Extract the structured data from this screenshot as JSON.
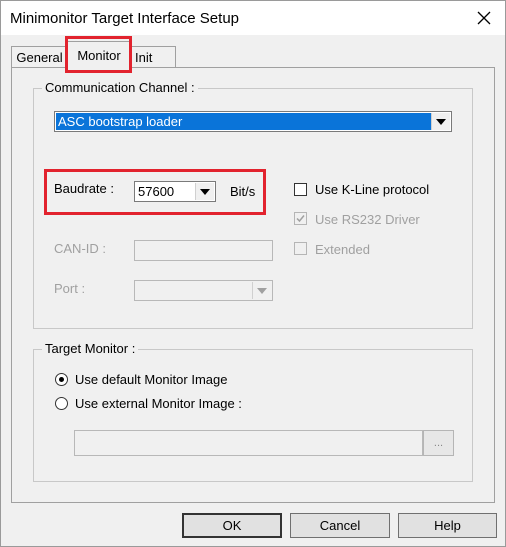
{
  "window": {
    "title": "Minimonitor Target Interface Setup"
  },
  "icons": {
    "close": "close-icon"
  },
  "tabs": [
    {
      "label": "General"
    },
    {
      "label": "Monitor",
      "selected": true
    },
    {
      "label": "Init"
    }
  ],
  "communication": {
    "legend": "Communication Channel :",
    "channel_value": "ASC bootstrap loader",
    "baudrate_label": "Baudrate :",
    "baudrate_value": "57600",
    "baudrate_unit": "Bit/s",
    "canid_label": "CAN-ID :",
    "canid_value": "",
    "port_label": "Port :",
    "port_value": "",
    "kline": {
      "label": "Use K-Line protocol",
      "checked": false,
      "enabled": true
    },
    "rs232": {
      "label": "Use RS232 Driver",
      "checked": true,
      "enabled": false
    },
    "extended": {
      "label": "Extended",
      "checked": false,
      "enabled": false
    }
  },
  "target": {
    "legend": "Target Monitor :",
    "default_label": "Use default Monitor Image",
    "external_label": "Use external Monitor Image :",
    "selected": "default",
    "path_value": "",
    "browse_label": "..."
  },
  "buttons": {
    "ok": "OK",
    "cancel": "Cancel",
    "help": "Help"
  },
  "highlight_color": "#e2232e",
  "selection_color": "#0a74d9"
}
